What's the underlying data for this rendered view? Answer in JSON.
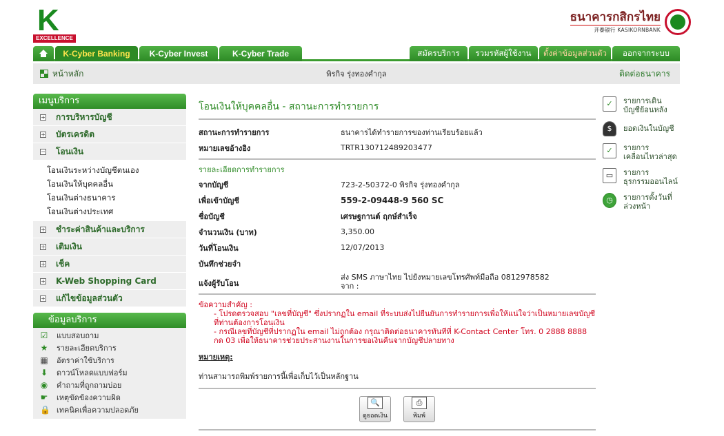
{
  "header": {
    "logo_text": "K",
    "logo_tag": "EXCELLENCE",
    "bank_name_thai": "ธนาคารกสิกรไทย",
    "bank_name_sub": "开泰银行 KASIKORNBANK"
  },
  "nav": {
    "tabs_left": [
      "K-Cyber Banking",
      "K-Cyber Invest",
      "K-Cyber Trade"
    ],
    "tabs_right": [
      "สมัครบริการ",
      "รวมรหัสผู้ใช้งาน",
      "ตั้งค่าข้อมูลส่วนตัว",
      "ออกจากระบบ"
    ]
  },
  "subbar": {
    "home": "หน้าหลัก",
    "user": "พิรกิจ รุ่งทองคำกุล",
    "contact": "ติดต่อธนาคาร"
  },
  "menu": {
    "title": "เมนูบริการ",
    "items": [
      "การบริหารบัญชี",
      "บัตรเครดิต",
      "โอนเงิน"
    ],
    "submenu": [
      "โอนเงินระหว่างบัญชีตนเอง",
      "โอนเงินให้บุคคลอื่น",
      "โอนเงินต่างธนาคาร",
      "โอนเงินต่างประเทศ"
    ],
    "items_after": [
      "ชำระค่าสินค้าและบริการ",
      "เติมเงิน",
      "เช็ค",
      "K-Web Shopping Card",
      "แก้ไขข้อมูลส่วนตัว"
    ]
  },
  "info": {
    "title": "ข้อมูลบริการ",
    "items": [
      "แบบสอบถาม",
      "รายละเอียดบริการ",
      "อัตราค่าใช้บริการ",
      "ดาวน์โหลดแบบฟอร์ม",
      "คำถามที่ถูกถามบ่อย",
      "เหตุขัดข้องความผิด",
      "เทคนิคเพื่อความปลอดภัย"
    ]
  },
  "main": {
    "title": "โอนเงินให้บุคคลอื่น - สถานะการทำรายการ",
    "status_label": "สถานะการทำรายการ",
    "status_value": "ธนาคารได้ทำรายการของท่านเรียบร้อยแล้ว",
    "ref_label": "หมายเลขอ้างอิง",
    "ref_value": "TRTR130712489203477",
    "detail_title": "รายละเอียดการทำรายการ",
    "from_label": "จากบัญชี",
    "from_value": "723-2-50372-0 พิรกิจ รุ่งทองคำกุล",
    "to_label": "เพื่อเข้าบัญชี",
    "to_value": "559-2-09448-9 560 SC",
    "name_label": "ชื่อบัญชี",
    "name_value": "เศรษฐกานต์ ฤกษ์สำเร็จ",
    "amount_label": "จำนวนเงิน (บาท)",
    "amount_value": "3,350.00",
    "date_label": "วันที่โอนเงิน",
    "date_value": "12/07/2013",
    "memo_label": "บันทึกช่วยจำ",
    "memo_value": "",
    "notify_label": "แจ้งผู้รับโอน",
    "notify_line1": "ส่ง SMS ภาษาไทย ไปยังหมายเลขโทรศัพท์มือถือ 0812978582",
    "notify_line2": "จาก :",
    "warn_head": "ข้อความสำคัญ :",
    "warn_1": "- โปรดตรวจสอบ \"เลขที่บัญชี\" ซึ่งปรากฏใน email ที่ระบบส่งไปยืนยันการทำรายการเพื่อให้แน่ใจว่าเป็นหมายเลขบัญชีที่ท่านต้องการโอนเงิน",
    "warn_2": "- กรณีเลขที่บัญชีที่ปรากฏใน email ไม่ถูกต้อง กรุณาติดต่อธนาคารทันทีที่ K-Contact Center โทร. 0 2888 8888 กด 03 เพื่อให้ธนาคารช่วยประสานงานในการขอเงินคืนจากบัญชีปลายทาง",
    "remark_title": "หมายเหตุ:",
    "remark_text": "ท่านสามารถพิมพ์รายการนี้เพื่อเก็บไว้เป็นหลักฐาน",
    "btn_balance": "ดูยอดเงิน",
    "btn_print": "พิมพ์"
  },
  "quick": [
    {
      "l1": "รายการเดิน",
      "l2": "บัญชีย้อนหลัง"
    },
    {
      "l1": "ยอดเงินในบัญชี",
      "l2": ""
    },
    {
      "l1": "รายการ",
      "l2": "เคลื่อนไหวล่าสุด"
    },
    {
      "l1": "รายการ",
      "l2": "ธุรกรรมออนไลน์"
    },
    {
      "l1": "รายการตั้งวันที่",
      "l2": "ล่วงหน้า"
    }
  ]
}
